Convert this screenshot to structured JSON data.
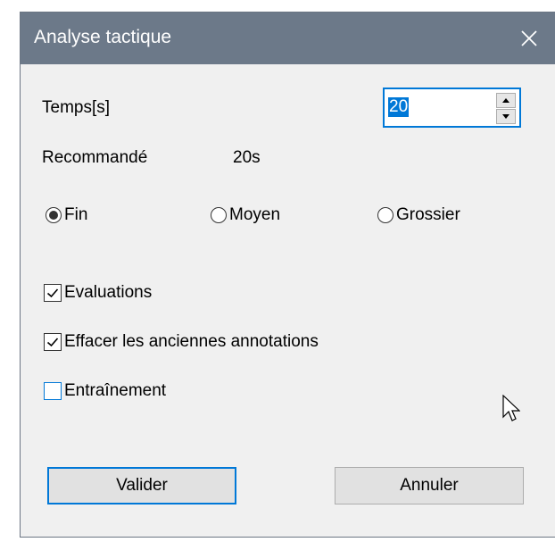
{
  "window": {
    "title": "Analyse tactique",
    "close_icon": "close-icon"
  },
  "time": {
    "label": "Temps[s]",
    "value": "20",
    "recommended_label": "Recommandé",
    "recommended_value": "20s"
  },
  "precision": {
    "options": [
      {
        "label": "Fin",
        "selected": true
      },
      {
        "label": "Moyen",
        "selected": false
      },
      {
        "label": "Grossier",
        "selected": false
      }
    ]
  },
  "options": {
    "items": [
      {
        "label": "Evaluations",
        "checked": true
      },
      {
        "label": "Effacer les anciennes annotations",
        "checked": true
      },
      {
        "label": "Entraînement",
        "checked": false
      }
    ]
  },
  "buttons": {
    "ok": "Valider",
    "cancel": "Annuler"
  },
  "colors": {
    "titlebar": "#6c7989",
    "accent": "#0078d7",
    "dialog_bg": "#f0f0f0"
  }
}
